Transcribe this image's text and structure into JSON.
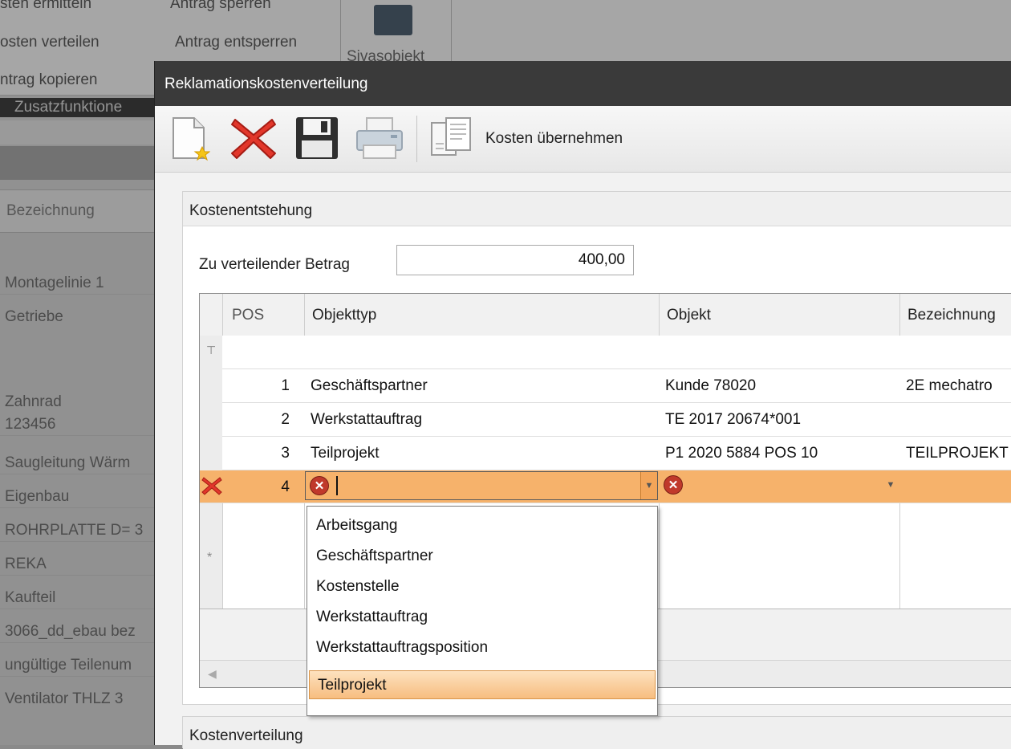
{
  "background": {
    "ribbon": {
      "row0": "sten ermitteln",
      "row0b": "Antrag sperren",
      "row1": "osten verteilen",
      "row1b": "Antrag entsperren",
      "row2": "ntrag kopieren",
      "sivas_label": "Sivasobjekt",
      "group_label": "Zusatzfunktione"
    },
    "list_header": "Bezeichnung",
    "list_rows": [
      "Montagelinie 1",
      "Getriebe",
      "Zahnrad",
      "123456",
      "Saugleitung Wärm",
      "Eigenbau",
      "ROHRPLATTE D= 3",
      "REKA",
      "Kaufteil",
      "3066_dd_ebau bez",
      "ungültige Teilenum",
      "Ventilator  THLZ  3"
    ]
  },
  "dialog": {
    "title": "Reklamationskostenverteilung",
    "toolbar": {
      "new_icon": "new-document-icon",
      "delete_icon": "delete-x-icon",
      "save_icon": "save-disk-icon",
      "print_icon": "printer-icon",
      "transfer_icon": "documents-icon",
      "transfer_label": "Kosten übernehmen"
    },
    "section1": {
      "title": "Kostenentstehung",
      "amount_label": "Zu verteilender Betrag",
      "amount_value": "400,00"
    },
    "grid": {
      "columns": [
        "POS",
        "Objekttyp",
        "Objekt",
        "Bezeichnung"
      ],
      "rows": [
        {
          "pos": "1",
          "objekttyp": "Geschäftspartner",
          "objekt": "Kunde 78020",
          "bezeichnung": "2E mechatro"
        },
        {
          "pos": "2",
          "objekttyp": "Werkstattauftrag",
          "objekt": "TE 2017 20674*001",
          "bezeichnung": ""
        },
        {
          "pos": "3",
          "objekttyp": "Teilprojekt",
          "objekt": "P1 2020 5884 POS 10",
          "bezeichnung": "TEILPROJEKT"
        }
      ],
      "edit_row": {
        "pos": "4",
        "objekttyp": "",
        "objekt": ""
      },
      "dropdown_options": [
        "Arbeitsgang",
        "Geschäftspartner",
        "Kostenstelle",
        "Werkstattauftrag",
        "Werkstattauftragsposition",
        "Teilprojekt"
      ],
      "dropdown_selected": "Teilprojekt",
      "filter_symbol": "⊤",
      "new_row_symbol": "*"
    },
    "section2": {
      "title": "Kostenverteilung"
    }
  },
  "colors": {
    "edit_row": "#f6b26b",
    "dialog_title_bg": "#3a3a3a",
    "error_red": "#c0392b"
  }
}
